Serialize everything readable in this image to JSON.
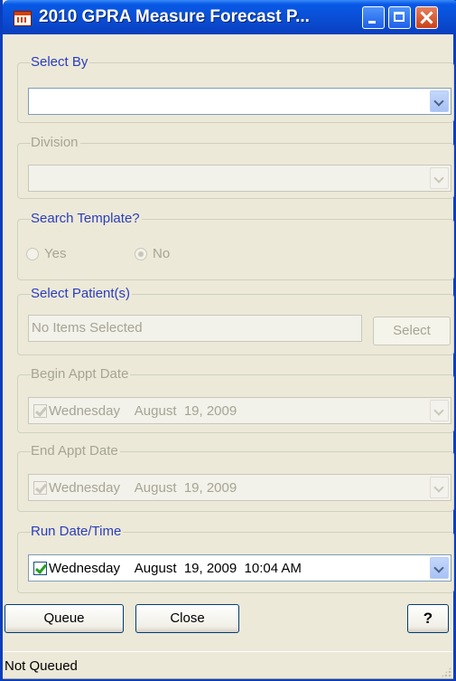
{
  "window": {
    "title": "2010 GPRA Measure Forecast P..."
  },
  "select_by": {
    "legend": "Select By",
    "value": ""
  },
  "division": {
    "legend": "Division",
    "value": ""
  },
  "search_template": {
    "legend": "Search Template?",
    "yes_label": "Yes",
    "no_label": "No",
    "selected": "No"
  },
  "patients": {
    "legend": "Select Patient(s)",
    "value": "No Items Selected",
    "select_label": "Select"
  },
  "begin_appt": {
    "legend": "Begin Appt Date",
    "value": "Wednesday    August  19, 2009",
    "checked": true
  },
  "end_appt": {
    "legend": "End Appt Date",
    "value": "Wednesday    August  19, 2009",
    "checked": true
  },
  "run_date": {
    "legend": "Run Date/Time",
    "value": "Wednesday    August  19, 2009  10:04 AM",
    "checked": true
  },
  "buttons": {
    "queue": "Queue",
    "close": "Close",
    "help": "?"
  },
  "status": {
    "text": "Not Queued"
  },
  "colors": {
    "titlebar": "#0a4fd6",
    "legend_enabled": "#2a3cbd",
    "disabled_text": "#a6a494",
    "face": "#ece9d8"
  }
}
